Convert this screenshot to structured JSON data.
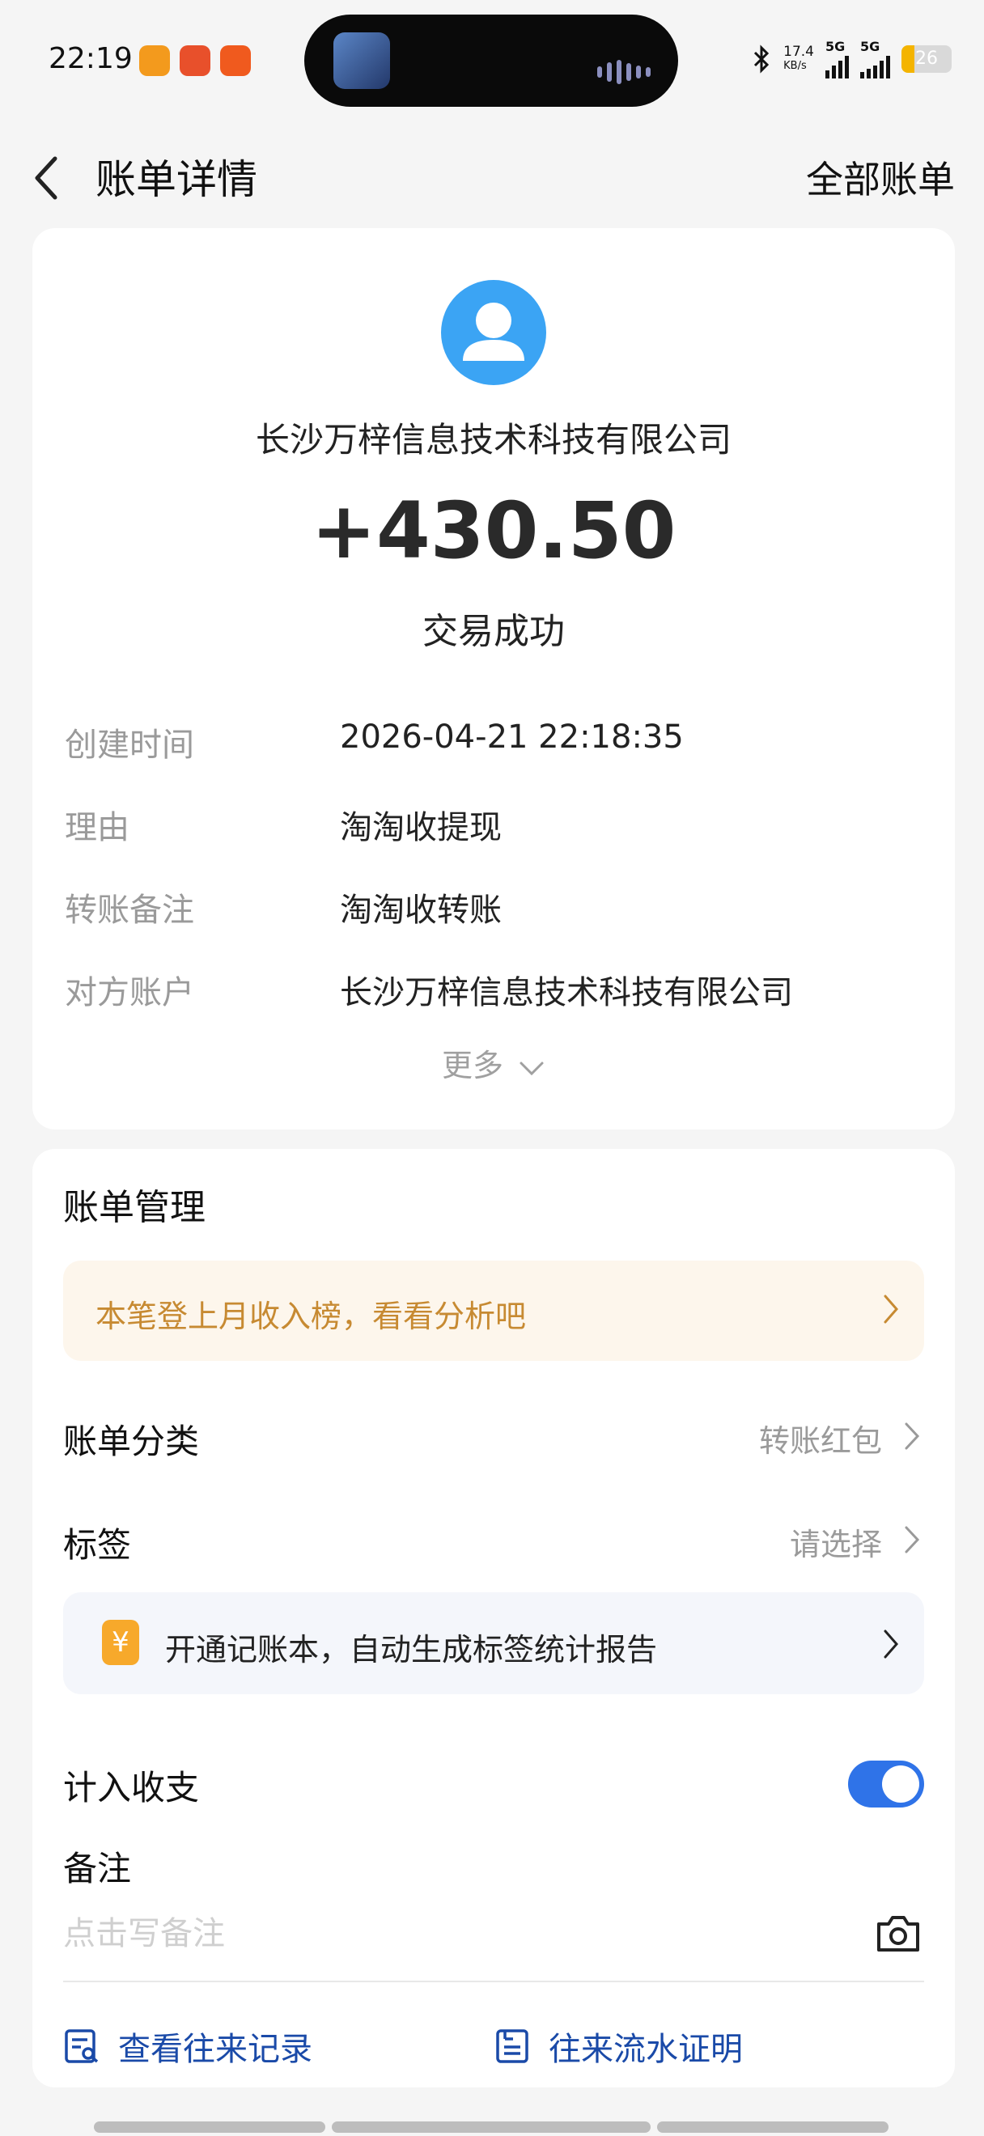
{
  "status_bar": {
    "time": "22:19",
    "network_speed": "17.4",
    "network_speed_unit": "KB/s",
    "signal_1": "5G",
    "signal_2": "5G",
    "battery": "26",
    "battery_level": 0.26,
    "battery_color": "#f4b400"
  },
  "nav": {
    "title": "账单详情",
    "right_action": "全部账单",
    "back_icon": "chevron-left-icon"
  },
  "transaction": {
    "avatar_icon": "user-avatar-icon",
    "avatar_color": "#3ba4f4",
    "payee": "长沙万梓信息技术科技有限公司",
    "amount": "+430.50",
    "status": "交易成功",
    "details": [
      {
        "label": "创建时间",
        "value": "2026-04-21  22:18:35"
      },
      {
        "label": "理由",
        "value": "淘淘收提现"
      },
      {
        "label": "转账备注",
        "value": "淘淘收转账"
      },
      {
        "label": "对方账户",
        "value": "长沙万梓信息技术科技有限公司"
      }
    ],
    "more": "更多"
  },
  "manage": {
    "title": "账单管理",
    "promo": "本笔登上月收入榜，看看分析吧",
    "category_label": "账单分类",
    "category_value": "转账红包",
    "tag_label": "标签",
    "tag_value": "请选择",
    "ledger_icon_glyph": "¥",
    "ledger_text": "开通记账本，自动生成标签统计报告",
    "include_label": "计入收支",
    "include_on": true,
    "note_label": "备注",
    "note_placeholder": "点击写备注",
    "link_records": "查看往来记录",
    "link_proof": "往来流水证明",
    "accent_color": "#2f73e8",
    "promo_color": "#c78a32"
  }
}
